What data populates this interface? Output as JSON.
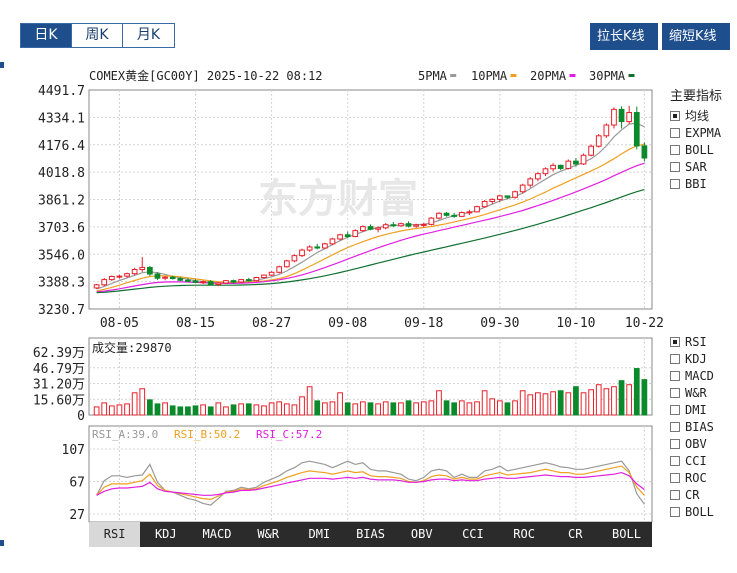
{
  "period_tabs": [
    {
      "label": "日K",
      "active": true
    },
    {
      "label": "周K",
      "active": false
    },
    {
      "label": "月K",
      "active": false
    }
  ],
  "buttons": {
    "stretch": "拉长K线",
    "shrink": "缩短K线"
  },
  "header": {
    "title": "COMEX黄金[GC00Y] 2025-10-22 08:12",
    "ma_legend": [
      {
        "label": "5PMA",
        "color": "#999999"
      },
      {
        "label": "10PMA",
        "color": "#f0a020"
      },
      {
        "label": "20PMA",
        "color": "#e020e0"
      },
      {
        "label": "30PMA",
        "color": "#107030"
      }
    ]
  },
  "side_main": {
    "title": "主要指标",
    "items": [
      {
        "label": "均线",
        "checked": true
      },
      {
        "label": "EXPMA",
        "checked": false
      },
      {
        "label": "BOLL",
        "checked": false
      },
      {
        "label": "SAR",
        "checked": false
      },
      {
        "label": "BBI",
        "checked": false
      }
    ]
  },
  "side_sub": {
    "items": [
      {
        "label": "RSI",
        "checked": true
      },
      {
        "label": "KDJ",
        "checked": false
      },
      {
        "label": "MACD",
        "checked": false
      },
      {
        "label": "W&R",
        "checked": false
      },
      {
        "label": "DMI",
        "checked": false
      },
      {
        "label": "BIAS",
        "checked": false
      },
      {
        "label": "OBV",
        "checked": false
      },
      {
        "label": "CCI",
        "checked": false
      },
      {
        "label": "ROC",
        "checked": false
      },
      {
        "label": "CR",
        "checked": false
      },
      {
        "label": "BOLL",
        "checked": false
      }
    ]
  },
  "bottom_tabs": [
    {
      "label": "RSI",
      "active": true
    },
    {
      "label": "KDJ",
      "active": false
    },
    {
      "label": "MACD",
      "active": false
    },
    {
      "label": "W&R",
      "active": false
    },
    {
      "label": "DMI",
      "active": false
    },
    {
      "label": "BIAS",
      "active": false
    },
    {
      "label": "OBV",
      "active": false
    },
    {
      "label": "CCI",
      "active": false
    },
    {
      "label": "ROC",
      "active": false
    },
    {
      "label": "CR",
      "active": false
    },
    {
      "label": "BOLL",
      "active": false
    }
  ],
  "watermark": "东方财富",
  "colors": {
    "up": "#e8202a",
    "down": "#0a8a2a",
    "grid": "#d4d4d4",
    "axis": "#888888"
  },
  "chart_data": [
    {
      "type": "candlestick",
      "name": "kline",
      "ylim": [
        3230.7,
        4491.7
      ],
      "y_ticks": [
        "4491.7",
        "4334.1",
        "4176.4",
        "4018.8",
        "3861.2",
        "3703.6",
        "3546.0",
        "3388.3",
        "3230.7"
      ],
      "x_ticks": [
        {
          "label": "08-05",
          "index": 3
        },
        {
          "label": "08-15",
          "index": 13
        },
        {
          "label": "08-27",
          "index": 23
        },
        {
          "label": "09-08",
          "index": 33
        },
        {
          "label": "09-18",
          "index": 43
        },
        {
          "label": "09-30",
          "index": 53
        },
        {
          "label": "10-10",
          "index": 63
        },
        {
          "label": "10-22",
          "index": 72
        }
      ],
      "candles": [
        [
          3352,
          3375,
          3346,
          3370
        ],
        [
          3370,
          3410,
          3362,
          3400
        ],
        [
          3400,
          3424,
          3392,
          3418
        ],
        [
          3418,
          3428,
          3406,
          3420
        ],
        [
          3420,
          3440,
          3412,
          3434
        ],
        [
          3434,
          3468,
          3424,
          3458
        ],
        [
          3458,
          3530,
          3444,
          3470
        ],
        [
          3470,
          3478,
          3420,
          3432
        ],
        [
          3432,
          3442,
          3398,
          3408
        ],
        [
          3408,
          3420,
          3396,
          3414
        ],
        [
          3414,
          3422,
          3400,
          3406
        ],
        [
          3406,
          3414,
          3392,
          3396
        ],
        [
          3396,
          3408,
          3384,
          3392
        ],
        [
          3392,
          3402,
          3380,
          3384
        ],
        [
          3384,
          3396,
          3374,
          3388
        ],
        [
          3388,
          3398,
          3368,
          3372
        ],
        [
          3372,
          3386,
          3362,
          3380
        ],
        [
          3380,
          3398,
          3376,
          3394
        ],
        [
          3394,
          3400,
          3376,
          3386
        ],
        [
          3386,
          3404,
          3380,
          3400
        ],
        [
          3400,
          3410,
          3388,
          3394
        ],
        [
          3394,
          3416,
          3390,
          3412
        ],
        [
          3412,
          3430,
          3406,
          3426
        ],
        [
          3426,
          3448,
          3420,
          3442
        ],
        [
          3442,
          3480,
          3436,
          3474
        ],
        [
          3474,
          3514,
          3468,
          3508
        ],
        [
          3508,
          3545,
          3500,
          3538
        ],
        [
          3538,
          3578,
          3530,
          3570
        ],
        [
          3570,
          3598,
          3560,
          3588
        ],
        [
          3588,
          3606,
          3574,
          3582
        ],
        [
          3582,
          3612,
          3578,
          3606
        ],
        [
          3606,
          3640,
          3598,
          3634
        ],
        [
          3634,
          3664,
          3626,
          3658
        ],
        [
          3658,
          3676,
          3640,
          3648
        ],
        [
          3648,
          3690,
          3644,
          3682
        ],
        [
          3682,
          3712,
          3674,
          3705
        ],
        [
          3705,
          3718,
          3684,
          3690
        ],
        [
          3690,
          3706,
          3672,
          3698
        ],
        [
          3698,
          3726,
          3690,
          3716
        ],
        [
          3716,
          3732,
          3702,
          3710
        ],
        [
          3710,
          3728,
          3704,
          3722
        ],
        [
          3722,
          3736,
          3700,
          3708
        ],
        [
          3708,
          3722,
          3698,
          3715
        ],
        [
          3715,
          3726,
          3700,
          3718
        ],
        [
          3718,
          3760,
          3712,
          3754
        ],
        [
          3754,
          3788,
          3746,
          3782
        ],
        [
          3782,
          3790,
          3762,
          3770
        ],
        [
          3770,
          3784,
          3756,
          3764
        ],
        [
          3764,
          3792,
          3760,
          3786
        ],
        [
          3786,
          3802,
          3772,
          3790
        ],
        [
          3790,
          3826,
          3786,
          3820
        ],
        [
          3820,
          3858,
          3812,
          3850
        ],
        [
          3850,
          3868,
          3836,
          3862
        ],
        [
          3862,
          3888,
          3848,
          3882
        ],
        [
          3882,
          3884,
          3862,
          3874
        ],
        [
          3874,
          3912,
          3866,
          3906
        ],
        [
          3906,
          3952,
          3898,
          3944
        ],
        [
          3944,
          3990,
          3930,
          3980
        ],
        [
          3980,
          4018,
          3966,
          4010
        ],
        [
          4010,
          4046,
          3996,
          4038
        ],
        [
          4038,
          4070,
          4022,
          4058
        ],
        [
          4058,
          4062,
          4030,
          4040
        ],
        [
          4040,
          4092,
          4034,
          4082
        ],
        [
          4082,
          4100,
          4052,
          4066
        ],
        [
          4066,
          4126,
          4060,
          4116
        ],
        [
          4116,
          4178,
          4110,
          4168
        ],
        [
          4168,
          4238,
          4160,
          4228
        ],
        [
          4228,
          4300,
          4216,
          4290
        ],
        [
          4290,
          4392,
          4270,
          4380
        ],
        [
          4380,
          4398,
          4270,
          4310
        ],
        [
          4310,
          4400,
          4296,
          4362
        ],
        [
          4362,
          4396,
          4150,
          4170
        ],
        [
          4170,
          4190,
          4080,
          4100
        ]
      ],
      "ma": {
        "5PMA": [
          3345,
          3360,
          3378,
          3395,
          3410,
          3425,
          3440,
          3445,
          3440,
          3430,
          3418,
          3410,
          3402,
          3394,
          3388,
          3385,
          3382,
          3383,
          3385,
          3388,
          3392,
          3398,
          3406,
          3416,
          3430,
          3450,
          3474,
          3500,
          3528,
          3556,
          3578,
          3602,
          3624,
          3644,
          3660,
          3676,
          3690,
          3700,
          3708,
          3712,
          3714,
          3716,
          3716,
          3718,
          3726,
          3740,
          3756,
          3768,
          3778,
          3786,
          3798,
          3816,
          3834,
          3852,
          3866,
          3878,
          3898,
          3924,
          3952,
          3978,
          4004,
          4024,
          4040,
          4058,
          4074,
          4096,
          4128,
          4170,
          4222,
          4262,
          4296,
          4300,
          4280
        ],
        "10PMA": [
          3335,
          3344,
          3355,
          3368,
          3382,
          3395,
          3408,
          3418,
          3422,
          3422,
          3420,
          3416,
          3410,
          3404,
          3398,
          3392,
          3388,
          3385,
          3384,
          3384,
          3386,
          3388,
          3392,
          3398,
          3406,
          3418,
          3434,
          3454,
          3476,
          3498,
          3520,
          3542,
          3564,
          3584,
          3602,
          3618,
          3634,
          3648,
          3660,
          3670,
          3680,
          3688,
          3694,
          3700,
          3706,
          3714,
          3722,
          3732,
          3742,
          3752,
          3762,
          3774,
          3788,
          3802,
          3816,
          3830,
          3846,
          3864,
          3884,
          3904,
          3926,
          3946,
          3966,
          3986,
          4006,
          4026,
          4046,
          4070,
          4096,
          4124,
          4150,
          4170,
          4180
        ],
        "20PMA": [
          3330,
          3334,
          3340,
          3347,
          3355,
          3363,
          3371,
          3378,
          3383,
          3386,
          3387,
          3387,
          3386,
          3384,
          3382,
          3380,
          3379,
          3378,
          3378,
          3379,
          3381,
          3384,
          3388,
          3393,
          3399,
          3407,
          3416,
          3427,
          3440,
          3454,
          3469,
          3485,
          3501,
          3518,
          3535,
          3551,
          3567,
          3583,
          3598,
          3612,
          3626,
          3639,
          3651,
          3662,
          3672,
          3682,
          3692,
          3702,
          3712,
          3722,
          3732,
          3742,
          3752,
          3763,
          3774,
          3786,
          3798,
          3812,
          3826,
          3841,
          3856,
          3872,
          3888,
          3905,
          3922,
          3940,
          3958,
          3977,
          3998,
          4018,
          4038,
          4056,
          4070
        ],
        "30PMA": [
          3325,
          3327,
          3331,
          3335,
          3340,
          3345,
          3350,
          3355,
          3359,
          3362,
          3364,
          3366,
          3367,
          3368,
          3368,
          3368,
          3368,
          3368,
          3368,
          3369,
          3370,
          3372,
          3374,
          3377,
          3381,
          3386,
          3392,
          3398,
          3405,
          3413,
          3422,
          3431,
          3441,
          3451,
          3462,
          3473,
          3484,
          3495,
          3506,
          3517,
          3528,
          3539,
          3549,
          3559,
          3569,
          3579,
          3589,
          3599,
          3609,
          3619,
          3629,
          3639,
          3650,
          3661,
          3672,
          3683,
          3695,
          3707,
          3719,
          3732,
          3745,
          3758,
          3772,
          3786,
          3800,
          3814,
          3829,
          3844,
          3860,
          3876,
          3892,
          3906,
          3918
        ]
      }
    },
    {
      "type": "bar",
      "name": "volume",
      "label": "成交量",
      "value": "29870",
      "ylim": [
        0,
        62.39
      ],
      "y_ticks": [
        "62.39万",
        "46.79万",
        "31.20万",
        "15.60万",
        "0"
      ],
      "values": [
        8,
        12,
        9,
        10,
        11,
        22,
        26,
        15,
        11,
        12,
        9,
        8,
        8,
        9,
        10,
        8,
        12,
        8,
        10,
        11,
        11,
        10,
        9,
        12,
        13,
        11,
        10,
        18,
        28,
        14,
        12,
        13,
        22,
        12,
        11,
        13,
        12,
        11,
        13,
        12,
        12,
        14,
        12,
        13,
        14,
        24,
        14,
        12,
        14,
        12,
        13,
        24,
        16,
        14,
        12,
        14,
        24,
        20,
        22,
        21,
        23,
        24,
        22,
        28,
        22,
        25,
        30,
        26,
        28,
        34,
        30,
        46,
        35
      ]
    },
    {
      "type": "line",
      "name": "rsi",
      "ylim": [
        27,
        107
      ],
      "y_ticks": [
        "107",
        "67",
        "27"
      ],
      "legend": [
        {
          "label": "RSI_A:39.0",
          "color": "#999999"
        },
        {
          "label": "RSI_B:50.2",
          "color": "#f0a020"
        },
        {
          "label": "RSI_C:57.2",
          "color": "#e020e0"
        }
      ],
      "series": [
        {
          "name": "RSI_A",
          "values": [
            50,
            68,
            74,
            74,
            72,
            74,
            75,
            88,
            66,
            56,
            54,
            50,
            46,
            44,
            40,
            38,
            46,
            55,
            56,
            60,
            58,
            60,
            66,
            70,
            74,
            80,
            84,
            90,
            92,
            90,
            88,
            84,
            88,
            92,
            88,
            90,
            82,
            80,
            80,
            78,
            76,
            70,
            68,
            72,
            80,
            82,
            80,
            72,
            76,
            72,
            72,
            80,
            82,
            86,
            80,
            82,
            84,
            86,
            88,
            90,
            88,
            85,
            84,
            82,
            82,
            84,
            86,
            88,
            90,
            92,
            80,
            52,
            39
          ]
        },
        {
          "name": "RSI_B",
          "values": [
            50,
            60,
            64,
            64,
            64,
            66,
            68,
            76,
            62,
            56,
            54,
            52,
            50,
            48,
            46,
            45,
            49,
            54,
            55,
            58,
            57,
            58,
            62,
            65,
            68,
            72,
            75,
            78,
            80,
            79,
            78,
            76,
            78,
            80,
            78,
            79,
            74,
            73,
            73,
            72,
            71,
            67,
            66,
            68,
            73,
            75,
            74,
            70,
            72,
            70,
            70,
            74,
            76,
            78,
            75,
            76,
            77,
            78,
            80,
            82,
            80,
            78,
            78,
            76,
            76,
            78,
            80,
            82,
            84,
            86,
            78,
            60,
            50
          ]
        },
        {
          "name": "RSI_C",
          "values": [
            50,
            55,
            58,
            59,
            59,
            60,
            61,
            66,
            58,
            55,
            54,
            53,
            52,
            51,
            50,
            50,
            51,
            53,
            54,
            56,
            56,
            57,
            59,
            61,
            63,
            65,
            67,
            69,
            71,
            71,
            71,
            70,
            71,
            72,
            71,
            72,
            70,
            69,
            69,
            69,
            68,
            66,
            66,
            67,
            69,
            70,
            70,
            68,
            69,
            68,
            68,
            70,
            71,
            72,
            71,
            71,
            72,
            73,
            74,
            75,
            74,
            73,
            73,
            72,
            72,
            73,
            74,
            75,
            76,
            78,
            74,
            64,
            57
          ]
        }
      ]
    }
  ]
}
